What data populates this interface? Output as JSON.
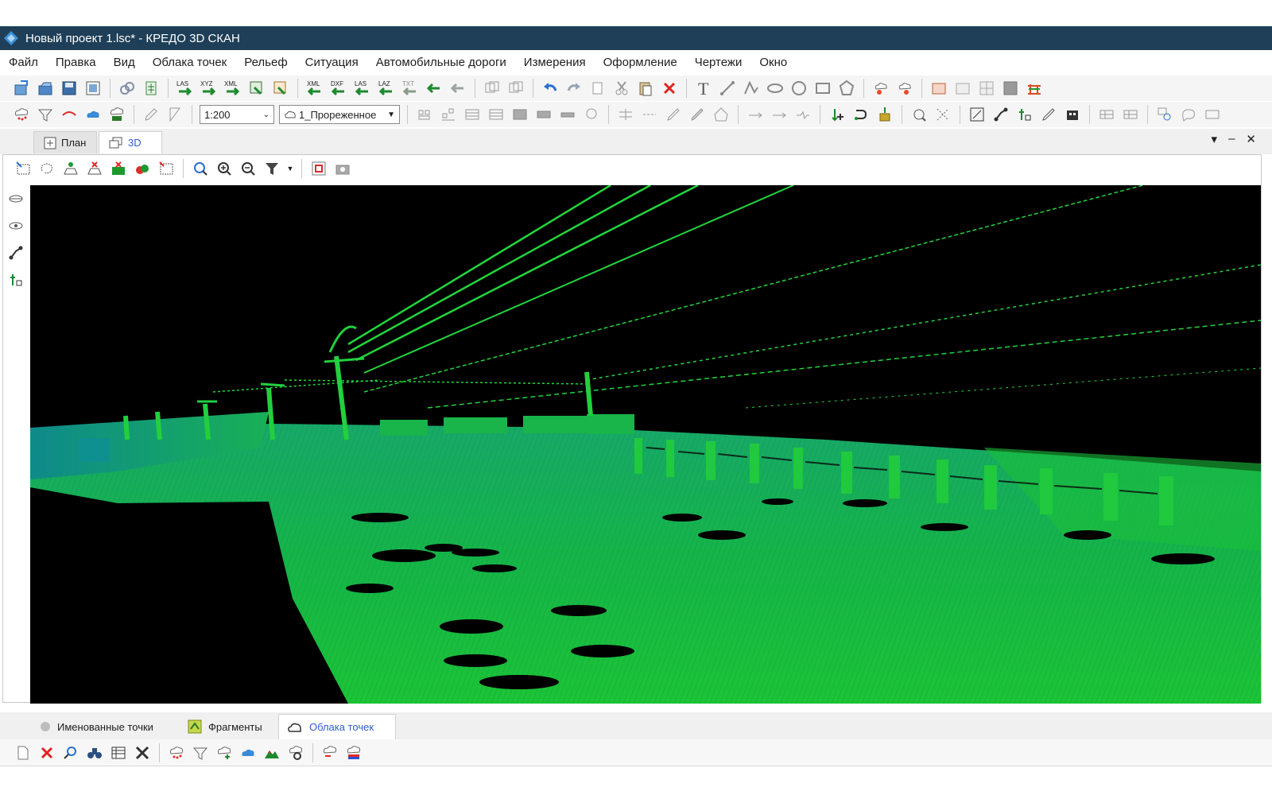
{
  "window": {
    "title": "Новый проект 1.lsc* - КРЕДО 3D СКАН"
  },
  "menu": [
    "Файл",
    "Правка",
    "Вид",
    "Облака точек",
    "Рельеф",
    "Ситуация",
    "Автомобильные дороги",
    "Измерения",
    "Оформление",
    "Чертежи",
    "Окно"
  ],
  "toolbar1": {
    "file_icons": [
      "new-project-icon",
      "open-icon",
      "save-icon",
      "save-all-icon"
    ],
    "import_labels": [
      "LAS",
      "XYZ",
      "XML"
    ],
    "export_labels": [
      "XML",
      "DXF",
      "LAS",
      "LAZ",
      "TXT"
    ],
    "text_tool": "T"
  },
  "toolbar2": {
    "scale": {
      "value": "1:200"
    },
    "cloud_select": {
      "value": "1_Прореженное"
    }
  },
  "doc_tabs": [
    {
      "label": "План",
      "active": false
    },
    {
      "label": "3D",
      "active": true
    }
  ],
  "window_controls": {
    "menu": "▾",
    "minimize": "–",
    "close": "✕"
  },
  "bottom_tabs": [
    {
      "label": "Именованные точки",
      "active": false
    },
    {
      "label": "Фрагменты",
      "active": false
    },
    {
      "label": "Облака точек",
      "active": true
    }
  ],
  "colors": {
    "titlebar": "#1e3f57",
    "accent_blue": "#2d5fcf",
    "viewport_bg": "#000000",
    "cloud_green": "#1fc43a",
    "cloud_teal": "#11a47c"
  }
}
